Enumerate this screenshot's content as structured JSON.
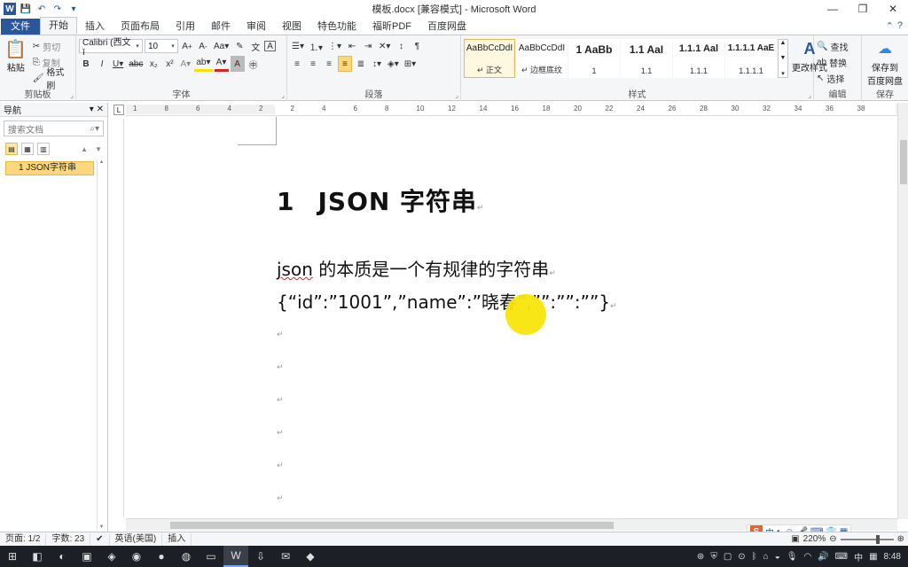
{
  "window": {
    "title": "模板.docx [兼容模式] - Microsoft Word",
    "app_icon": "W",
    "controls": {
      "min": "—",
      "restore": "❐",
      "close": "✕"
    }
  },
  "tabs": [
    "文件",
    "开始",
    "插入",
    "页面布局",
    "引用",
    "邮件",
    "审阅",
    "视图",
    "特色功能",
    "福昕PDF",
    "百度网盘"
  ],
  "ribbon": {
    "clipboard": {
      "label": "剪贴板",
      "paste": "粘贴",
      "cut": "剪切",
      "copy": "复制",
      "format_painter": "格式刷"
    },
    "font": {
      "label": "字体",
      "name": "Calibri (西文ī",
      "size": "10"
    },
    "paragraph": {
      "label": "段落"
    },
    "styles": {
      "label": "样式",
      "items": [
        {
          "sample": "AaBbCcDdI",
          "name": "↵ 正文"
        },
        {
          "sample": "AaBbCcDdI",
          "name": "↵ 边框底纹"
        },
        {
          "sample": "1 AaBb",
          "name": "1"
        },
        {
          "sample": "1.1 AaI",
          "name": "1.1"
        },
        {
          "sample": "1.1.1 Aal",
          "name": "1.1.1"
        },
        {
          "sample": "1.1.1.1 AaE",
          "name": "1.1.1.1"
        }
      ],
      "change_styles": "更改样式"
    },
    "editing": {
      "label": "编辑",
      "find": "查找",
      "replace": "替换",
      "select": "选择"
    },
    "save": {
      "label": "保存",
      "save_to": "保存到",
      "baidu": "百度网盘"
    }
  },
  "nav": {
    "title": "导航",
    "search_placeholder": "搜索文档",
    "items": [
      "1 JSON字符串"
    ]
  },
  "ruler": {
    "marks": [
      "1",
      "8",
      "6",
      "4",
      "2",
      "2",
      "4",
      "6",
      "8",
      "10",
      "12",
      "14",
      "16",
      "18",
      "20",
      "22",
      "24",
      "26",
      "28",
      "30",
      "32",
      "34",
      "36",
      "38"
    ]
  },
  "document": {
    "heading_num": "1",
    "heading_text": "JSON 字符串",
    "line1_word": "json",
    "line1_rest": " 的本质是一个有规律的字符串",
    "line2": "{“id”:”1001”,”name”:”晓春”,””:””:””}",
    "para_mark": "↵"
  },
  "status": {
    "page": "页面: 1/2",
    "words": "字数: 23",
    "language": "英语(美国)",
    "mode": "插入",
    "zoom": "220%"
  },
  "ime": {
    "logo": "S",
    "mode": "中"
  },
  "taskbar": {
    "time": "8:48",
    "lang": "中"
  }
}
